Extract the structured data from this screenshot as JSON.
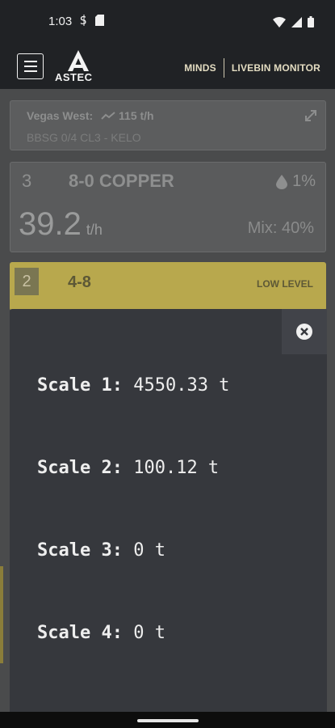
{
  "status_bar": {
    "time": "1:03",
    "icons": [
      "sim-icon",
      "sd-card-icon",
      "wifi-icon",
      "signal-icon",
      "battery-icon"
    ]
  },
  "app_bar": {
    "logo_text": "ASTEC",
    "nav_minds": "MINDS",
    "nav_livebin": "LIVEBIN MONITOR"
  },
  "site_card": {
    "site": "Vegas West:",
    "flow": "115 t/h",
    "mix_code": "BBSG 0/4 CL3 - KELO"
  },
  "bin_cards": [
    {
      "number": "3",
      "material": "8-0 COPPER",
      "moisture": "1%",
      "rate": "39.2",
      "rate_unit": "t/h",
      "mix": "Mix: 40%"
    },
    {
      "number": "2",
      "material": "4-8",
      "status": "LOW LEVEL"
    }
  ],
  "scales_modal": {
    "scales": [
      {
        "label": "Scale 1:",
        "value": "4550.33 t"
      },
      {
        "label": "Scale 2:",
        "value": "100.12 t"
      },
      {
        "label": "Scale 3:",
        "value": "0 t"
      },
      {
        "label": "Scale 4:",
        "value": "0 t"
      }
    ]
  },
  "colors": {
    "app_bar": "#202225",
    "accent_gold": "#b8a84d",
    "modal_bg": "#36383d",
    "overlay_bg": "#4a4b4c"
  }
}
